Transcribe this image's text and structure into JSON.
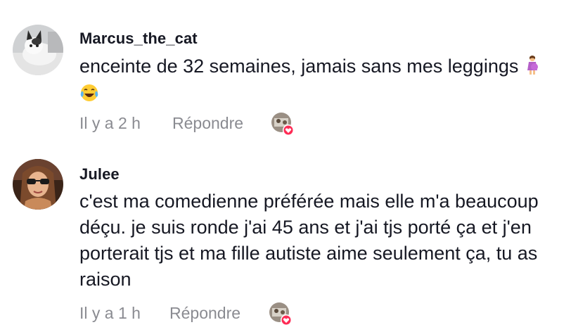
{
  "comments": [
    {
      "username": "Marcus_the_cat",
      "text": "enceinte de 32 semaines, jamais sans mes leggings",
      "emojis": [
        "pregnant-woman-emoji",
        "tears-of-joy-emoji"
      ],
      "time": "Il y a 2 h",
      "reply_label": "Répondre",
      "liked_by_creator": true
    },
    {
      "username": "Julee",
      "text": "c'est ma comedienne préférée mais elle m'a beaucoup déçu. je suis ronde j'ai 45 ans et j'ai tjs porté ça et j'en porterait tjs et ma fille autiste aime seulement ça, tu as raison",
      "time": "Il y a 1 h",
      "reply_label": "Répondre",
      "liked_by_creator": true
    }
  ],
  "colors": {
    "text": "#161823",
    "meta": "#8a8b91",
    "heart_badge": "#fe2c55"
  }
}
